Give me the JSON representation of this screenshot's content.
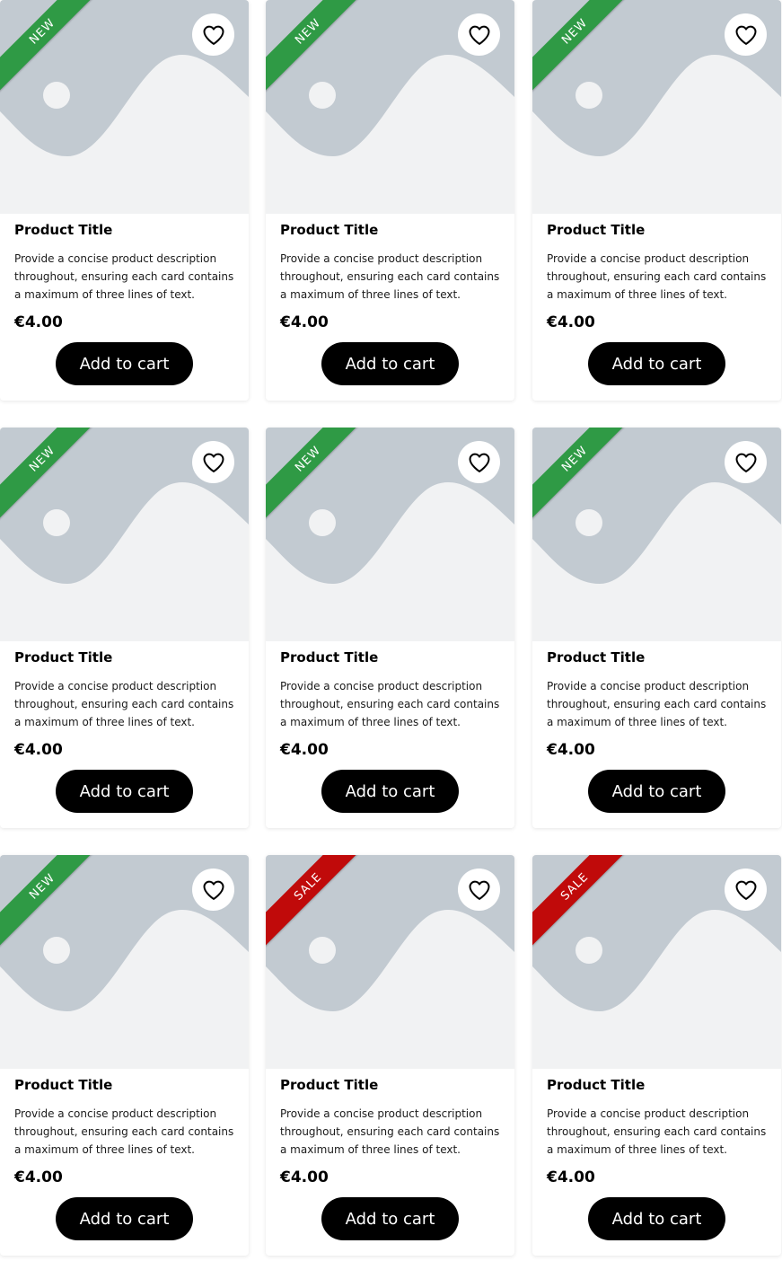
{
  "colors": {
    "placeholder_bg": "#f1f2f3",
    "placeholder_shape": "#c2cad1",
    "new_ribbon": "#2f9a45",
    "sale_ribbon": "#c00a0a",
    "button_bg": "#000000"
  },
  "icons": {
    "favorite": "heart-outline-icon"
  },
  "products": [
    {
      "badge": "NEW",
      "badge_type": "new",
      "title": "Product Title",
      "description": "Provide a concise product description throughout, ensuring each card contains a maximum of three lines of text.",
      "price": "€4.00",
      "button_label": "Add to cart"
    },
    {
      "badge": "NEW",
      "badge_type": "new",
      "title": "Product Title",
      "description": "Provide a concise product description throughout, ensuring each card contains a maximum of three lines of text.",
      "price": "€4.00",
      "button_label": "Add to cart"
    },
    {
      "badge": "NEW",
      "badge_type": "new",
      "title": "Product Title",
      "description": "Provide a concise product description throughout, ensuring each card contains a maximum of three lines of text.",
      "price": "€4.00",
      "button_label": "Add to cart"
    },
    {
      "badge": "NEW",
      "badge_type": "new",
      "title": "Product Title",
      "description": "Provide a concise product description throughout, ensuring each card contains a maximum of three lines of text.",
      "price": "€4.00",
      "button_label": "Add to cart"
    },
    {
      "badge": "NEW",
      "badge_type": "new",
      "title": "Product Title",
      "description": "Provide a concise product description throughout, ensuring each card contains a maximum of three lines of text.",
      "price": "€4.00",
      "button_label": "Add to cart"
    },
    {
      "badge": "NEW",
      "badge_type": "new",
      "title": "Product Title",
      "description": "Provide a concise product description throughout, ensuring each card contains a maximum of three lines of text.",
      "price": "€4.00",
      "button_label": "Add to cart"
    },
    {
      "badge": "NEW",
      "badge_type": "new",
      "title": "Product Title",
      "description": "Provide a concise product description throughout, ensuring each card contains a maximum of three lines of text.",
      "price": "€4.00",
      "button_label": "Add to cart"
    },
    {
      "badge": "SALE",
      "badge_type": "sale",
      "title": "Product Title",
      "description": "Provide a concise product description throughout, ensuring each card contains a maximum of three lines of text.",
      "price": "€4.00",
      "button_label": "Add to cart"
    },
    {
      "badge": "SALE",
      "badge_type": "sale",
      "title": "Product Title",
      "description": "Provide a concise product description throughout, ensuring each card contains a maximum of three lines of text.",
      "price": "€4.00",
      "button_label": "Add to cart"
    }
  ]
}
